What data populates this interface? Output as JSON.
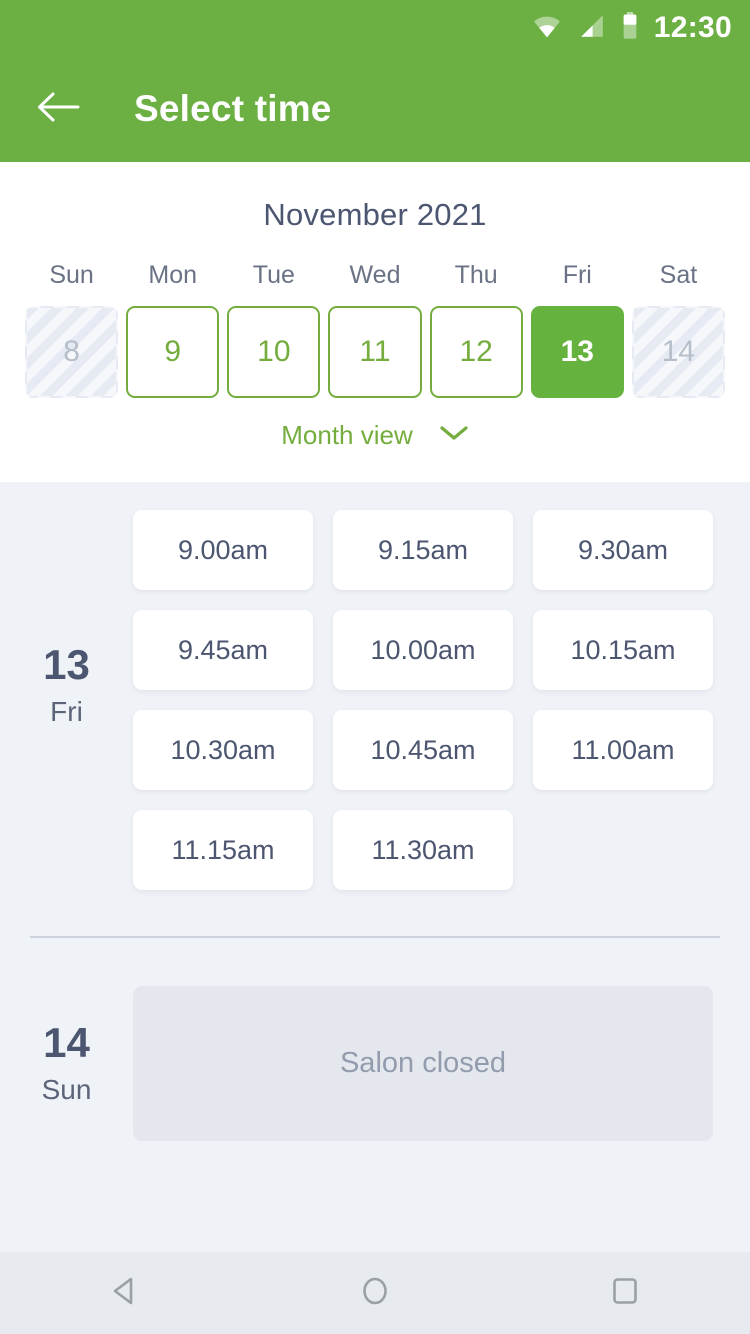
{
  "status_bar": {
    "time": "12:30",
    "icons": [
      "wifi-icon",
      "cell-signal-icon",
      "battery-icon"
    ]
  },
  "app_bar": {
    "back_icon": "arrow-left-icon",
    "title": "Select time"
  },
  "calendar": {
    "month_title": "November 2021",
    "day_of_week_headers": [
      "Sun",
      "Mon",
      "Tue",
      "Wed",
      "Thu",
      "Fri",
      "Sat"
    ],
    "days": [
      {
        "num": "8",
        "state": "disabled"
      },
      {
        "num": "9",
        "state": "available"
      },
      {
        "num": "10",
        "state": "available"
      },
      {
        "num": "11",
        "state": "available"
      },
      {
        "num": "12",
        "state": "available"
      },
      {
        "num": "13",
        "state": "selected"
      },
      {
        "num": "14",
        "state": "disabled"
      }
    ],
    "month_view_label": "Month view",
    "month_view_icon": "chevron-down-icon"
  },
  "schedule": [
    {
      "day_number": "13",
      "day_name": "Fri",
      "slots": [
        "9.00am",
        "9.15am",
        "9.30am",
        "9.45am",
        "10.00am",
        "10.15am",
        "10.30am",
        "10.45am",
        "11.00am",
        "11.15am",
        "11.30am"
      ]
    },
    {
      "day_number": "14",
      "day_name": "Sun",
      "closed_label": "Salon closed"
    }
  ],
  "nav_bar": {
    "back_icon": "triangle-back-icon",
    "home_icon": "circle-home-icon",
    "recents_icon": "square-recents-icon"
  },
  "colors": {
    "brand_green": "#6cb043",
    "selected_green": "#66b23e",
    "text_dark": "#4c5670",
    "page_background": "#eff2f7"
  }
}
